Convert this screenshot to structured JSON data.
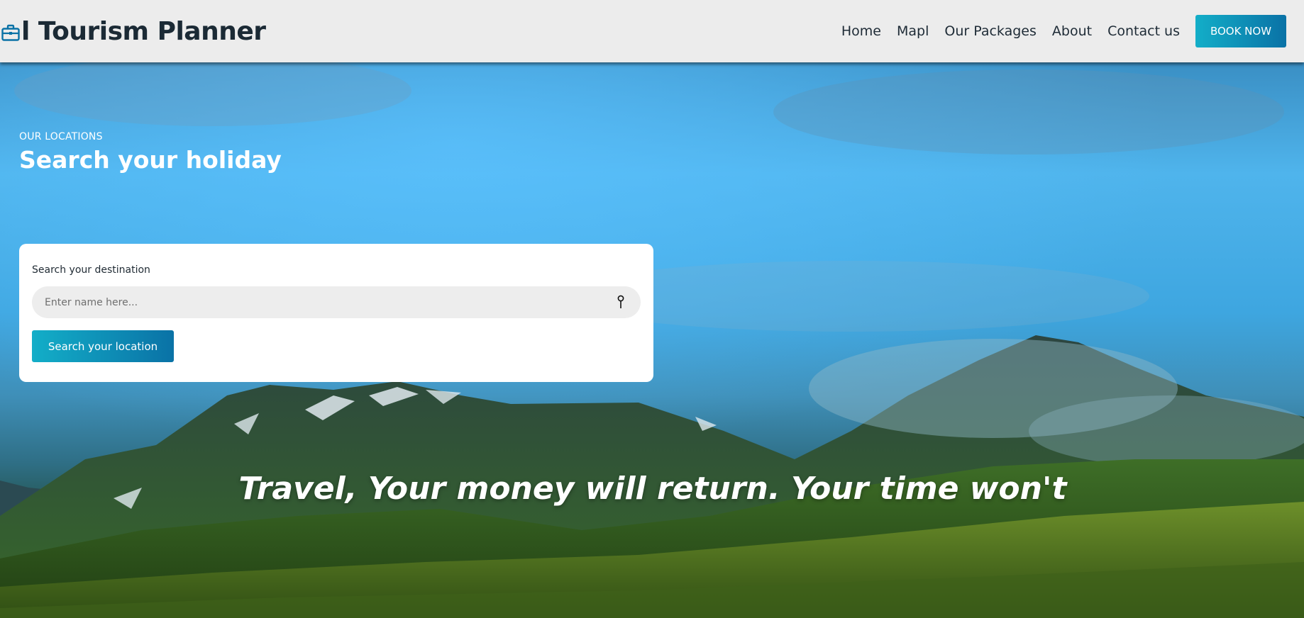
{
  "header": {
    "brand_icon": "suitcase-icon",
    "brand_title": "l Tourism Planner",
    "nav": [
      "Home",
      "Mapl",
      "Our Packages",
      "About",
      "Contact us"
    ],
    "book_label": "BOOK NOW"
  },
  "hero": {
    "eyebrow": "OUR LOCATIONS",
    "title": "Search your holiday",
    "search": {
      "label": "Search your destination",
      "placeholder": "Enter name here...",
      "value": "",
      "icon": "map-pin-icon",
      "button_label": "Search your location"
    },
    "quote": "Travel, Your money will return. Your time won't"
  },
  "colors": {
    "accent_start": "#13aec8",
    "accent_end": "#0a72a6",
    "brand_icon": "#0a72a6",
    "header_bg": "#ececec",
    "heading_text": "#1b2a35"
  }
}
